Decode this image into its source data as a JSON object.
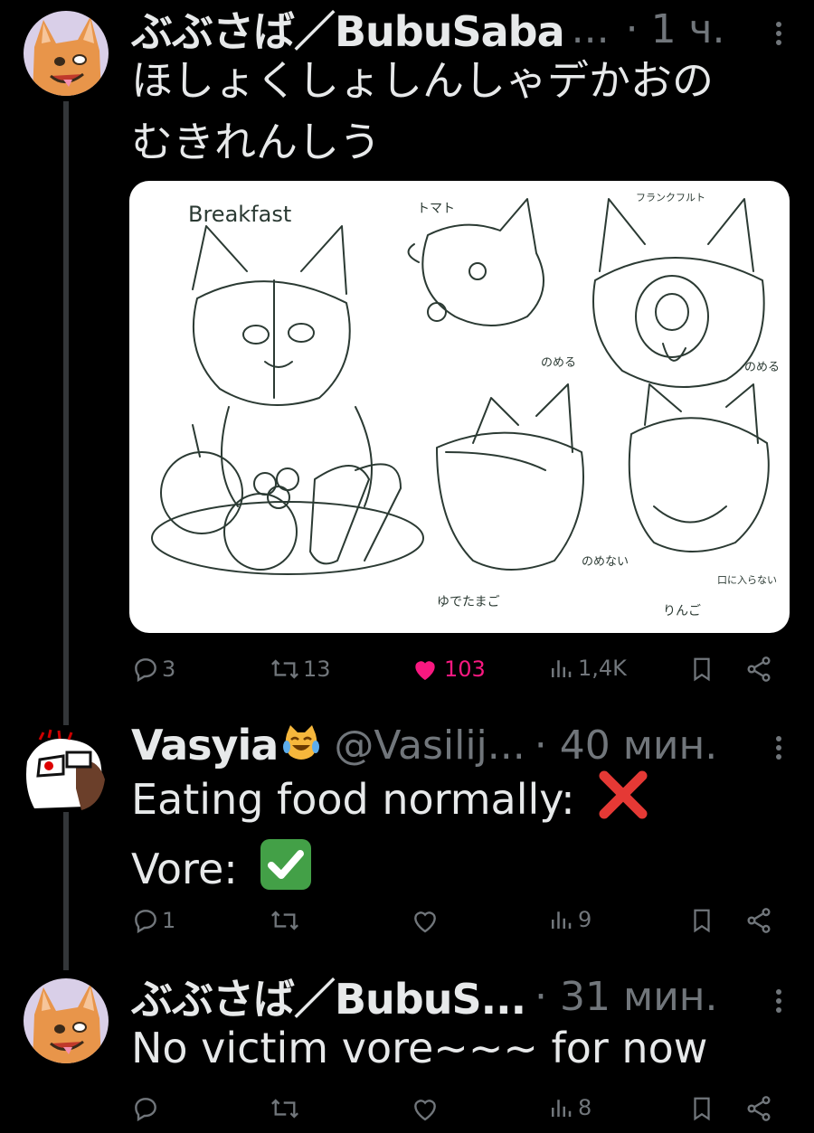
{
  "colors": {
    "background": "#000000",
    "text": "#e7e9ea",
    "muted": "#71767b",
    "like": "#f91880",
    "thread_line": "#333639"
  },
  "tweets": [
    {
      "name": "ぶぶさば／BubuSaba",
      "truncation": "...",
      "time": "· 1 ч.",
      "text_lines": [
        "ほしょくしょしんしゃデかおの",
        "むきれんしう"
      ],
      "media": {
        "type": "image",
        "labels": [
          "Breakfast",
          "トマト",
          "フランクフルト",
          "のめる",
          "のめる",
          "のめない",
          "ゆでたまご",
          "りんご",
          "口に入らない"
        ]
      },
      "actions": {
        "replies": "3",
        "retweets": "13",
        "likes": "103",
        "views": "1,4K",
        "liked": true
      }
    },
    {
      "name": "Vasyia",
      "name_emoji": "cat-tears-of-joy",
      "handle": "@Vasilij...",
      "time": "· 40 мин.",
      "text_lines": [
        "Eating food normally:",
        "Vore:"
      ],
      "line_emojis": [
        "cross-mark",
        "check-mark"
      ],
      "actions": {
        "replies": "1",
        "retweets": "",
        "likes": "",
        "views": "9",
        "liked": false
      }
    },
    {
      "name": "ぶぶさば／BubuS...",
      "time": "· 31 мин.",
      "text_lines": [
        "No victim vore~~~ for now"
      ],
      "actions": {
        "replies": "",
        "retweets": "",
        "likes": "",
        "views": "8",
        "liked": false
      }
    }
  ]
}
